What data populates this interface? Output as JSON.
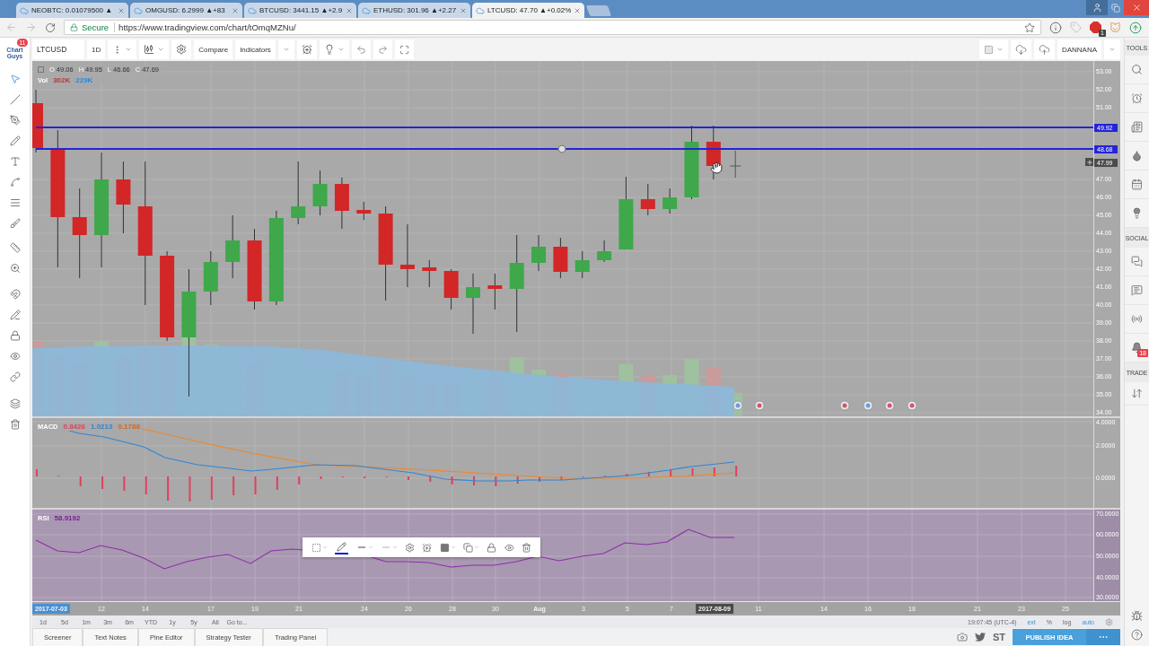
{
  "browser": {
    "tabs": [
      {
        "title": "NEOBTC: 0.01079500 ▲",
        "selected": false
      },
      {
        "title": "OMGUSD: 6.2999 ▲+83",
        "selected": false
      },
      {
        "title": "BTCUSD: 3441.15 ▲+2.9",
        "selected": false
      },
      {
        "title": "ETHUSD: 301.96 ▲+2.27",
        "selected": false
      },
      {
        "title": "LTCUSD: 47.70 ▲+0.02%",
        "selected": true
      }
    ],
    "security_label": "Secure",
    "url": "https://www.tradingview.com/chart/tOmqMZNu/",
    "extension_badge": "1"
  },
  "logo": {
    "text": "Chart Guys",
    "badge": "11"
  },
  "toolbar": {
    "symbol": "LTCUSD",
    "interval": "1D",
    "buttons": [
      "Compare",
      "Indicators"
    ],
    "user": "DANNANA"
  },
  "sidebar": {
    "sections": [
      "TOOLS",
      "SOCIAL",
      "TRADE"
    ],
    "alerts_badge": "18"
  },
  "legend": {
    "ohlc": [
      {
        "key": "O",
        "value": "49.06"
      },
      {
        "key": "H",
        "value": "49.95"
      },
      {
        "key": "L",
        "value": "46.66"
      },
      {
        "key": "C",
        "value": "47.69"
      }
    ],
    "volume": {
      "label": "Vol",
      "values": [
        {
          "text": "302K",
          "color": "#b03a3a"
        },
        {
          "text": "229K",
          "color": "#2f86d6"
        }
      ]
    }
  },
  "price_axis": {
    "labels": [
      "53.00",
      "52.00",
      "51.00",
      "47.00",
      "46.00",
      "45.00",
      "44.00",
      "43.00",
      "42.00",
      "41.00",
      "40.00",
      "39.00",
      "38.00",
      "37.00",
      "36.00",
      "35.00",
      "34.00"
    ],
    "tags": [
      {
        "text": "49.92",
        "kind": "line"
      },
      {
        "text": "48.68",
        "kind": "line"
      },
      {
        "text": "47.99",
        "kind": "crosshair"
      }
    ]
  },
  "macd": {
    "label": "MACD",
    "values": [
      {
        "text": "0.8426",
        "color": "#e2405a"
      },
      {
        "text": "1.0213",
        "color": "#2f86d6"
      },
      {
        "text": "0.1788",
        "color": "#d06a1c"
      }
    ],
    "axis": [
      "4.0000",
      "2.0000",
      "0.0000"
    ]
  },
  "rsi": {
    "label": "RSI",
    "value": "58.9192",
    "axis": [
      "70.0000",
      "60.0000",
      "50.0000",
      "40.0000",
      "30.0000"
    ]
  },
  "time_axis": [
    {
      "text": "2017-07-03",
      "kind": "range_start"
    },
    {
      "text": "12",
      "kind": "tick"
    },
    {
      "text": "14",
      "kind": "tick"
    },
    {
      "text": "17",
      "kind": "tick"
    },
    {
      "text": "19",
      "kind": "tick"
    },
    {
      "text": "21",
      "kind": "tick"
    },
    {
      "text": "24",
      "kind": "tick"
    },
    {
      "text": "26",
      "kind": "tick"
    },
    {
      "text": "28",
      "kind": "tick"
    },
    {
      "text": "30",
      "kind": "tick"
    },
    {
      "text": "Aug",
      "kind": "month"
    },
    {
      "text": "3",
      "kind": "tick"
    },
    {
      "text": "5",
      "kind": "tick"
    },
    {
      "text": "7",
      "kind": "tick"
    },
    {
      "text": "2017-08-09",
      "kind": "crosshair"
    },
    {
      "text": "11",
      "kind": "tick"
    },
    {
      "text": "14",
      "kind": "tick"
    },
    {
      "text": "16",
      "kind": "tick"
    },
    {
      "text": "18",
      "kind": "tick"
    },
    {
      "text": "21",
      "kind": "tick"
    },
    {
      "text": "23",
      "kind": "tick"
    },
    {
      "text": "25",
      "kind": "tick"
    }
  ],
  "ranges": [
    "1d",
    "5d",
    "1m",
    "3m",
    "6m",
    "YTD",
    "1y",
    "5y",
    "All",
    "Go to..."
  ],
  "status": {
    "clock": "19:07:45 (UTC-4)",
    "options": [
      {
        "label": "ext",
        "on": true
      },
      {
        "label": "%",
        "on": false
      },
      {
        "label": "log",
        "on": false
      },
      {
        "label": "auto",
        "on": true
      }
    ]
  },
  "bottom_tabs": [
    "Screener",
    "Text Notes",
    "Pine Editor",
    "Strategy Tester",
    "Trading Panel"
  ],
  "share": {
    "st_label": "ST",
    "publish": "PUBLISH IDEA"
  }
}
